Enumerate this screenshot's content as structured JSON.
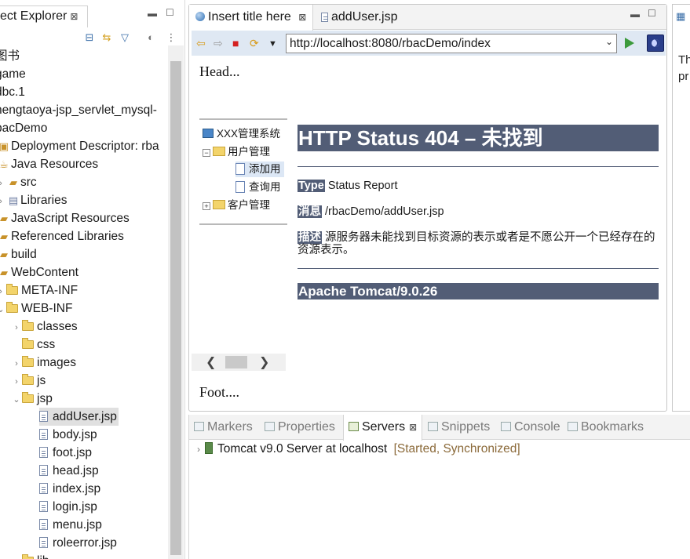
{
  "explorer": {
    "tab_label": "ect Explorer",
    "close_glyph": "⊠",
    "items": [
      {
        "label": "图书",
        "level": 0,
        "kind": "project"
      },
      {
        "label": "game",
        "level": 0,
        "kind": "project"
      },
      {
        "label": "dbc.1",
        "level": 0,
        "kind": "project"
      },
      {
        "label": "hengtaoya-jsp_servlet_mysql-",
        "level": 0,
        "kind": "project"
      },
      {
        "label": "bacDemo",
        "level": 0,
        "kind": "project"
      },
      {
        "label": "Deployment Descriptor: rba",
        "level": 1,
        "kind": "descriptor"
      },
      {
        "label": "Java Resources",
        "level": 1,
        "kind": "java"
      },
      {
        "label": "src",
        "level": 2,
        "kind": "src"
      },
      {
        "label": "Libraries",
        "level": 2,
        "kind": "lib"
      },
      {
        "label": "JavaScript Resources",
        "level": 1,
        "kind": "js"
      },
      {
        "label": "Referenced Libraries",
        "level": 1,
        "kind": "lib"
      },
      {
        "label": "build",
        "level": 1,
        "kind": "folder"
      },
      {
        "label": "WebContent",
        "level": 1,
        "kind": "folder"
      },
      {
        "label": "META-INF",
        "level": 2,
        "kind": "folder"
      },
      {
        "label": "WEB-INF",
        "level": 2,
        "kind": "folder"
      },
      {
        "label": "classes",
        "level": 3,
        "kind": "folder"
      },
      {
        "label": "css",
        "level": 3,
        "kind": "folder"
      },
      {
        "label": "images",
        "level": 3,
        "kind": "folder"
      },
      {
        "label": "js",
        "level": 3,
        "kind": "folder"
      },
      {
        "label": "jsp",
        "level": 3,
        "kind": "folder"
      },
      {
        "label": "addUser.jsp",
        "level": 4,
        "kind": "file",
        "selected": true
      },
      {
        "label": "body.jsp",
        "level": 4,
        "kind": "file"
      },
      {
        "label": "foot.jsp",
        "level": 4,
        "kind": "file"
      },
      {
        "label": "head.jsp",
        "level": 4,
        "kind": "file"
      },
      {
        "label": "index.jsp",
        "level": 4,
        "kind": "file"
      },
      {
        "label": "login.jsp",
        "level": 4,
        "kind": "file"
      },
      {
        "label": "menu.jsp",
        "level": 4,
        "kind": "file"
      },
      {
        "label": "roleerror.jsp",
        "level": 4,
        "kind": "file"
      },
      {
        "label": "lib",
        "level": 3,
        "kind": "folder"
      }
    ]
  },
  "editor": {
    "tabs": [
      {
        "label": "Insert title here",
        "close": "⊠"
      },
      {
        "label": "addUser.jsp"
      }
    ],
    "url": "http://localhost:8080/rbacDemo/index",
    "head_text": "Head...",
    "foot_text": "Foot....",
    "menu": {
      "root": "XXX管理系统",
      "group1": "用户管理",
      "item1": "添加用",
      "item2": "查询用",
      "group2": "客户管理"
    },
    "error": {
      "title": "HTTP Status 404 – 未找到",
      "type_label": "Type",
      "type_value": "Status Report",
      "message_label": "消息",
      "message_value": "/rbacDemo/addUser.jsp",
      "desc_label": "描述",
      "desc_value": "源服务器未能找到目标资源的表示或者是不愿公开一个已经存在的资源表示。",
      "footer": "Apache Tomcat/9.0.26"
    }
  },
  "outline": {
    "line1": "Th",
    "line2": "pr"
  },
  "bottom": {
    "tabs": [
      "Markers",
      "Properties",
      "Servers",
      "Snippets",
      "Console",
      "Bookmarks"
    ],
    "active_tab": "Servers",
    "server_name": "Tomcat v9.0 Server at localhost",
    "server_status": "[Started, Synchronized]"
  },
  "colors": {
    "tomcat_header": "#525d76",
    "selection": "#e0e0e0",
    "nav_bar": "#dfe8f3"
  }
}
